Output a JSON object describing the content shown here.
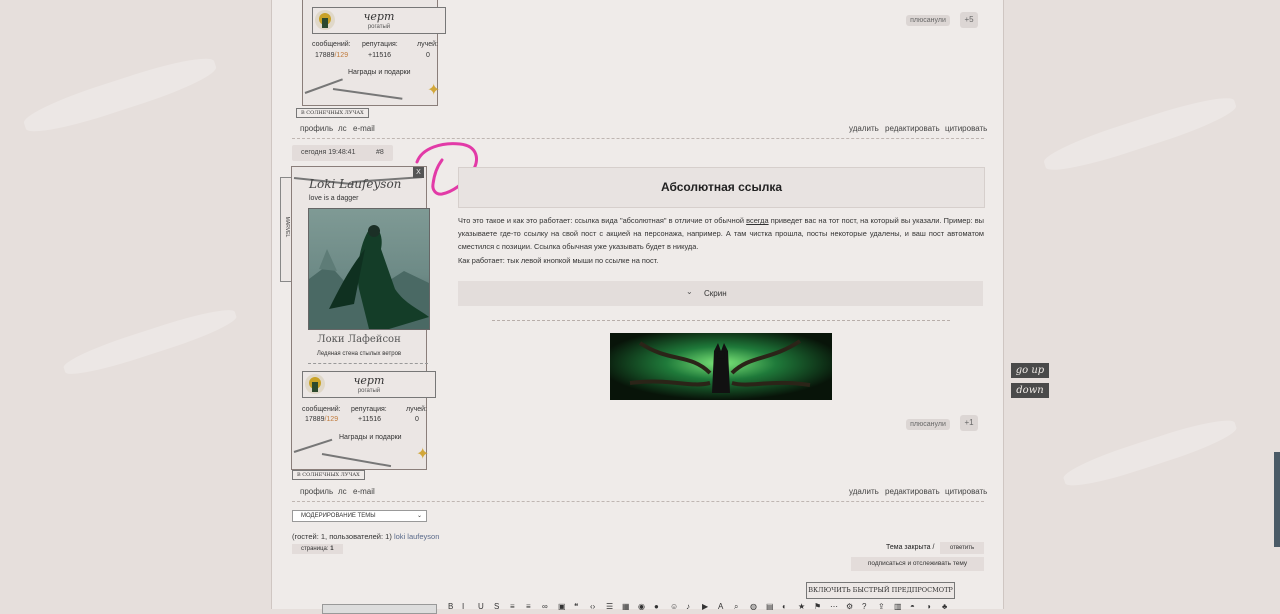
{
  "post_top": {
    "rank_title": "черт",
    "rank_sub": "рогатый",
    "stats_labels": [
      "сообщений:",
      "репутация:",
      "лучей:"
    ],
    "msg_count": "17889",
    "msg_extra": "/129",
    "reputation": "+11516",
    "rays": "0",
    "awards": "Награды и подарки",
    "sun_tag": "В СОЛНЕЧНЫХ ЛУЧАХ",
    "like_label": "плюсанули",
    "like_count": "+5",
    "links": [
      "профиль",
      "лс",
      "e-mail"
    ],
    "actions": [
      "удалить",
      "редактировать",
      "цитировать"
    ]
  },
  "post_main": {
    "time": "сегодня 19:48:41",
    "number": "#8",
    "close_mark": "X",
    "fandom_tag": "MARVEL",
    "username": "Loki Laufeyson",
    "status": "love is a dagger",
    "ru_name": "Локи Лафейсон",
    "ru_sub": "Ледяная стена стылых ветров",
    "rank_title": "черт",
    "rank_sub": "рогатый",
    "stats_labels": [
      "сообщений:",
      "репутация:",
      "лучей:"
    ],
    "msg_count": "17889",
    "msg_extra": "/129",
    "reputation": "+11516",
    "rays": "0",
    "awards": "Награды и подарки",
    "sun_tag": "В СОЛНЕЧНЫХ ЛУЧАХ",
    "heading": "Абсолютная ссылка",
    "para1_a": "Что это такое и как это работает: ссылка вида \"абсолютная\" в отличие от обычной ",
    "para1_u": "всегда",
    "para1_b": " приведет вас на тот пост, на который вы указали. Пример: вы указываете где-то ссылку на свой пост с акцией на персонажа, например. А там чистка прошла, посты некоторые удалены, и ваш пост автоматом сместился с позиции. Ссылка обычная уже указывать будет в никуда.",
    "para2": "Как работает: тык левой кнопкой мыши по ссылке на пост.",
    "spoiler_label": "Скрин",
    "like_label": "плюсанули",
    "like_count": "+1",
    "links": [
      "профиль",
      "лс",
      "e-mail"
    ],
    "actions": [
      "удалить",
      "редактировать",
      "цитировать"
    ]
  },
  "footer": {
    "moderation_select": "МОДЕРИРОВАНИЕ ТЕМЫ",
    "guests_text": "(гостей: 1, пользователей: 1)",
    "guest_user": "loki laufeyson",
    "page_label": "страница:",
    "page_num": "1",
    "topic_closed": "Тема закрыта /",
    "reply": "ответить",
    "subscribe": "подписаться и отслеживать тему",
    "preview_btn": "ВКЛЮЧИТЬ БЫСТРЫЙ ПРЕДПРОСМОТР"
  },
  "side": {
    "go_up": "go up",
    "down": "down"
  },
  "colors": {
    "accent_pink": "#e23aa7",
    "star_gold": "#d2a73a",
    "bg": "#e6dfdc"
  }
}
